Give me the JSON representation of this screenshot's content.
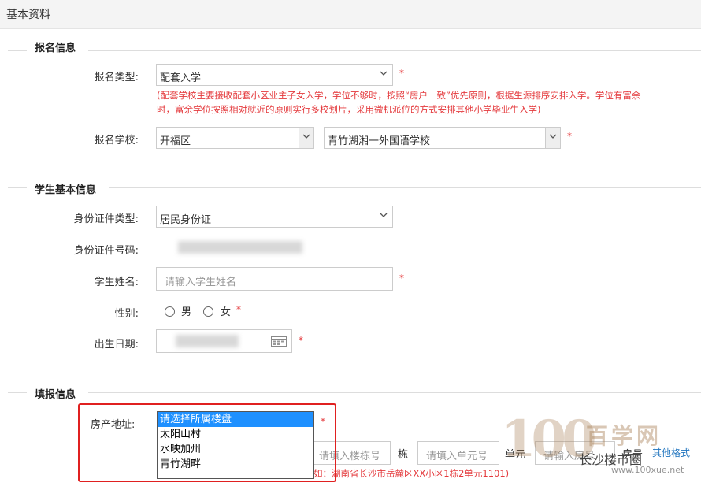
{
  "header": {
    "title": "基本资料"
  },
  "sections": {
    "registration": "报名信息",
    "student": "学生基本信息",
    "fill": "填报信息"
  },
  "registration": {
    "type_label": "报名类型:",
    "type_value": "配套入学",
    "note": "(配套学校主要接收配套小区业主子女入学，学位不够时，按照“房户一致”优先原则，根据生源排序安排入学。学位有富余时，富余学位按照相对就近的原则实行多校划片，采用微机派位的方式安排其他小学毕业生入学)",
    "school_label": "报名学校:",
    "district_value": "开福区",
    "school_value": "青竹湖湘一外国语学校"
  },
  "student": {
    "id_type_label": "身份证件类型:",
    "id_type_value": "居民身份证",
    "id_number_label": "身份证件号码:",
    "name_label": "学生姓名:",
    "name_placeholder": "请输入学生姓名",
    "gender_label": "性别:",
    "gender_male": "男",
    "gender_female": "女",
    "birth_label": "出生日期:"
  },
  "fill": {
    "address_label": "房产地址:",
    "dropdown_options": [
      "请选择所属楼盘",
      "太阳山村",
      "水映加州",
      "青竹湖畔"
    ],
    "building_placeholder": "请填入楼栋号",
    "building_unit": "栋",
    "unit_placeholder": "请填入单元号",
    "unit_unit": "单元",
    "room_placeholder": "请输入房号",
    "room_unit": "房号",
    "other_link": "其他格式",
    "example": "如：湖南省长沙市岳麓区XX小区1栋2单元1101)"
  },
  "required_mark": "*",
  "watermark": {
    "number": "100",
    "cn": "百学网",
    "social": "长沙楼市圈",
    "url": "www.100xue.net"
  },
  "colors": {
    "required": "#e4393c",
    "selected": "#1e90ff",
    "highlight_box": "#e02020"
  }
}
